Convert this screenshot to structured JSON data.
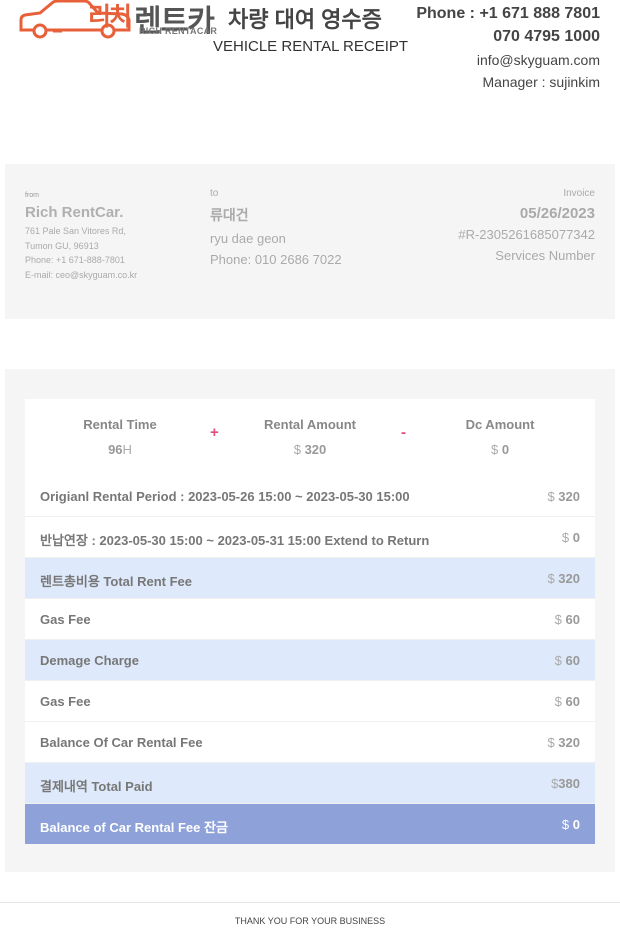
{
  "header": {
    "logo_ko": "리치렌트카",
    "logo_ko_part1": "리치",
    "logo_ko_part2": "렌트카",
    "logo_en": "RICH RENTACAR",
    "title_ko": "차량 대여 영수증",
    "title_en": "VEHICLE RENTAL RECEIPT",
    "phone1": "Phone : +1 671 888 7801",
    "phone2": "070 4795 1000",
    "email": "info@skyguam.com",
    "manager": "Manager : sujinkim",
    "accent_color": "#e8603a"
  },
  "from": {
    "label": "from",
    "name": "Rich RentCar.",
    "address1": "761 Pale San Vitores Rd,",
    "address2": "Tumon GU, 96913",
    "phone": "Phone: +1 671-888-7801",
    "email": "E-mail: ceo@skyguam.co.kr"
  },
  "to": {
    "label": "to",
    "name": "류대건",
    "name_en": "ryu dae geon",
    "phone": "Phone: 010 2686 7022"
  },
  "invoice": {
    "label": "Invoice",
    "date": "05/26/2023",
    "number": "#R-2305261685077342",
    "services_label": "Services Number"
  },
  "summary": {
    "rental_time_label": "Rental Time",
    "rental_time_value": "96",
    "rental_time_unit": "H",
    "plus": "+",
    "rental_amount_label": "Rental Amount",
    "rental_amount_currency": "$",
    "rental_amount_value": "320",
    "minus": "-",
    "dc_amount_label": "Dc Amount",
    "dc_amount_currency": "$",
    "dc_amount_value": "0",
    "operator_color": "#e24d7a"
  },
  "rows": [
    {
      "label": "Origianl Rental Period : 2023-05-26 15:00 ~ 2023-05-30 15:00",
      "currency": "$",
      "value": "320"
    },
    {
      "label": "반납연장 : 2023-05-30 15:00 ~ 2023-05-31 15:00 Extend to Return",
      "currency": "$",
      "value": "0"
    },
    {
      "label": "렌트총비용 Total Rent Fee",
      "currency": "$",
      "value": "320"
    },
    {
      "label": "Gas Fee",
      "currency": "$",
      "value": "60"
    },
    {
      "label": "Demage Charge",
      "currency": "$",
      "value": "60"
    },
    {
      "label": "Gas Fee",
      "currency": "$",
      "value": "60"
    },
    {
      "label": "Balance Of Car Rental Fee",
      "currency": "$",
      "value": "320"
    },
    {
      "label": "결제내역 Total Paid",
      "currency": "$",
      "value": "380"
    },
    {
      "label": "Balance of Car Rental Fee 잔금",
      "currency": "$",
      "value": "0"
    }
  ],
  "colors": {
    "highlight_row": "#deeafb",
    "total_row": "#8ea2d9"
  },
  "footer": {
    "text": "THANK YOU FOR YOUR BUSINESS"
  }
}
